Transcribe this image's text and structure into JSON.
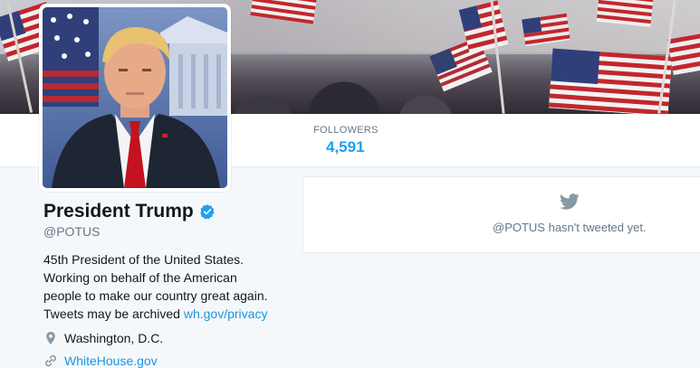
{
  "profile": {
    "name": "President Trump",
    "handle": "@POTUS",
    "bio_lines": [
      "45th President of the United States.",
      "Working on behalf of the American",
      "people to make our country great again.",
      "Tweets may be archived "
    ],
    "bio_link": "wh.gov/privacy",
    "location": "Washington, D.C.",
    "website": "WhiteHouse.gov",
    "verified": true
  },
  "stats": {
    "followers_label": "FOLLOWERS",
    "followers_value": "4,591"
  },
  "timeline": {
    "empty_message": "@POTUS hasn't tweeted yet."
  },
  "icons": {
    "verified": "verified-badge-icon",
    "location": "map-pin-icon",
    "website": "link-icon",
    "timeline": "twitter-bird-icon"
  },
  "colors": {
    "accent": "#1da1f2",
    "link": "#1b95e0",
    "muted": "#657786",
    "background": "#f5f8fa"
  }
}
